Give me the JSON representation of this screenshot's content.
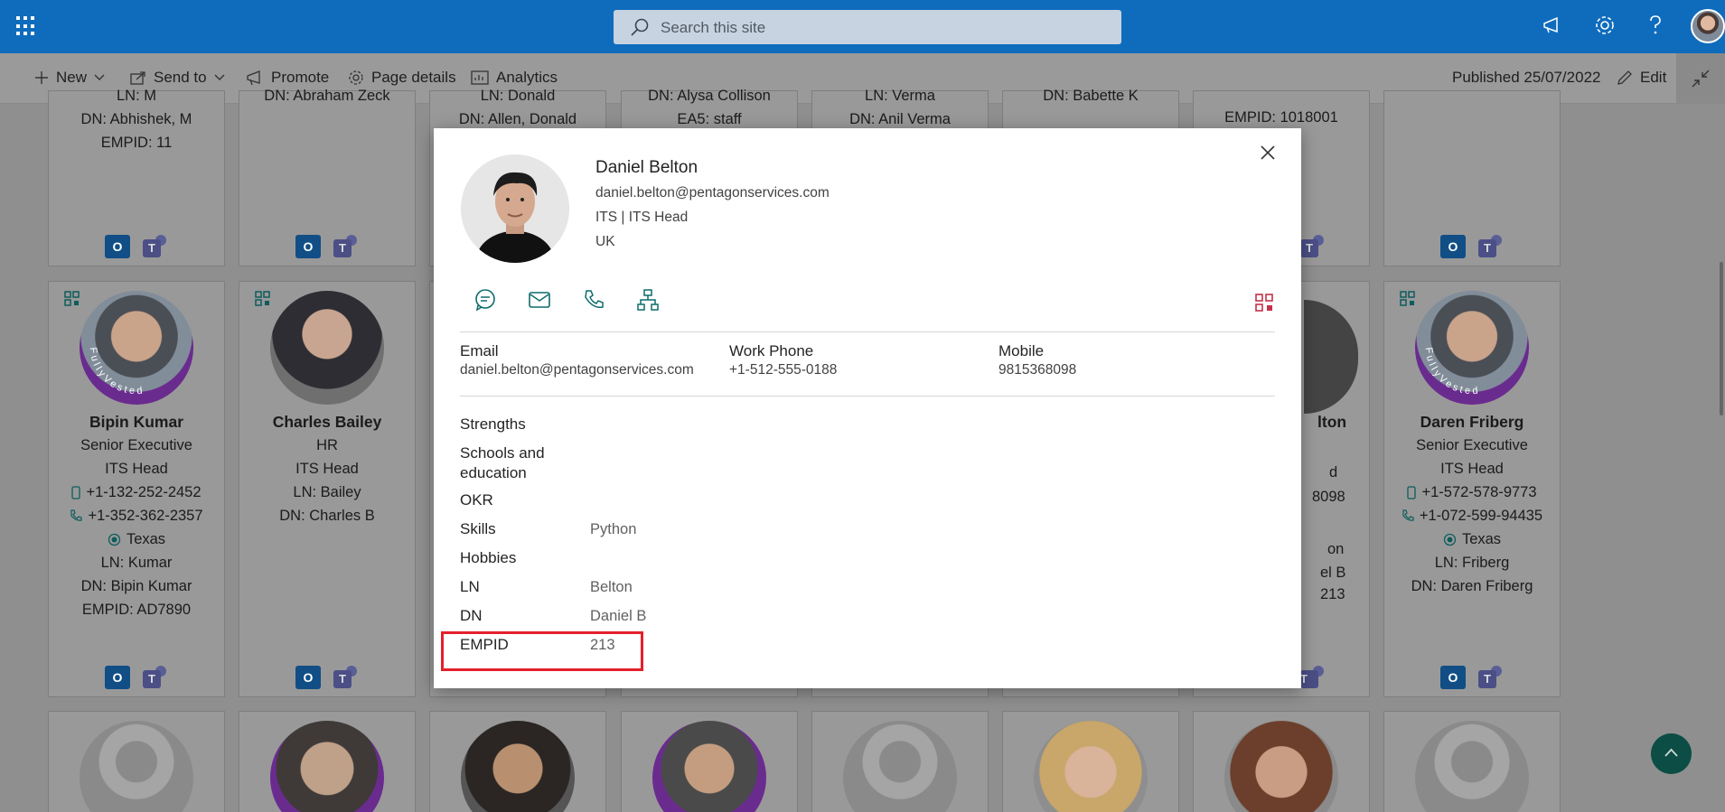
{
  "search": {
    "placeholder": "Search this site"
  },
  "commandbar": {
    "new": "New",
    "send_to": "Send to",
    "promote": "Promote",
    "page_details": "Page details",
    "analytics": "Analytics",
    "published": "Published 25/07/2022",
    "edit": "Edit"
  },
  "cards_top": [
    {
      "l1": "LN: M",
      "l2": "DN: Abhishek, M",
      "l3": "EMPID: 11"
    },
    {
      "l1": "DN: Abraham Zeck"
    },
    {
      "l1": "LN: Donald",
      "l2": "DN: Allen, Donald"
    },
    {
      "l1": "DN: Alysa Collison",
      "l2": "EA5: staff"
    },
    {
      "l1": "LN: Verma",
      "l2": "DN: Anil Verma"
    },
    {
      "l1": "DN: Babette K"
    },
    {
      "l1": "EMPID: 1018001"
    }
  ],
  "cards_mid": [
    {
      "name": "Bipin Kumar",
      "title": "Senior Executive",
      "dept": "ITS Head",
      "mobile": "+1-132-252-2452",
      "phone": "+1-352-362-2357",
      "location": "Texas",
      "ln": "LN: Kumar",
      "dn": "DN: Bipin Kumar",
      "empid": "EMPID: AD7890"
    },
    {
      "name": "Charles Bailey",
      "title": "HR",
      "dept": "ITS Head",
      "ln": "LN: Bailey",
      "dn": "DN: Charles B"
    },
    {
      "partial_name": "lton",
      "p1": "d",
      "p2": "8098",
      "p3": "on",
      "p4": "el B",
      "p5": "213"
    },
    {
      "name": "Daren Friberg",
      "title": "Senior Executive",
      "dept": "ITS Head",
      "mobile": "+1-572-578-9773",
      "phone": "+1-072-599-94435",
      "location": "Texas",
      "ln": "LN: Friberg",
      "dn": "DN: Daren Friberg"
    }
  ],
  "badge_text": "FullyVested",
  "app_icons": {
    "outlook": "O",
    "teams": "T"
  },
  "modal": {
    "name": "Daniel Belton",
    "email": "daniel.belton@pentagonservices.com",
    "dept": "ITS | ITS Head",
    "country": "UK",
    "contact": {
      "email_label": "Email",
      "email_value": "daniel.belton@pentagonservices.com",
      "work_label": "Work Phone",
      "work_value": "+1-512-555-0188",
      "mobile_label": "Mobile",
      "mobile_value": "9815368098"
    },
    "fields": [
      {
        "label": "Strengths",
        "value": ""
      },
      {
        "label": "Schools and education",
        "value": ""
      },
      {
        "label": "OKR",
        "value": ""
      },
      {
        "label": "Skills",
        "value": "Python"
      },
      {
        "label": "Hobbies",
        "value": ""
      },
      {
        "label": "LN",
        "value": "Belton"
      },
      {
        "label": "DN",
        "value": "Daniel B"
      },
      {
        "label": "EMPID",
        "value": "213"
      }
    ]
  },
  "colors": {
    "suitebar": "#0f6cbd",
    "accent": "#0f6c6c",
    "highlight": "#e4202b"
  }
}
